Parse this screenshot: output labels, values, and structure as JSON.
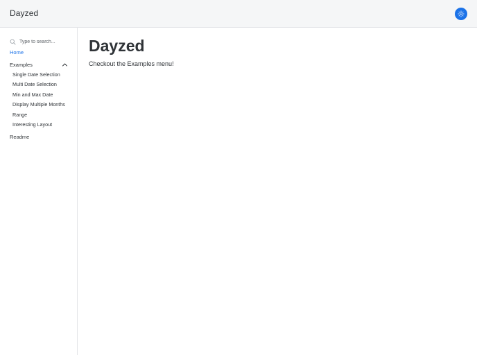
{
  "header": {
    "title": "Dayzed",
    "theme_toggle_icon": "sun-icon",
    "accent_color": "#1b72e8"
  },
  "sidebar": {
    "search": {
      "placeholder": "Type to search...",
      "value": "",
      "icon": "search-icon"
    },
    "home_label": "Home",
    "examples": {
      "label": "Examples",
      "expanded": true,
      "icon": "chevron-up-icon",
      "items": [
        {
          "label": "Single Date Selection"
        },
        {
          "label": "Multi Date Selection"
        },
        {
          "label": "Min and Max Date"
        },
        {
          "label": "Display Multiple Months"
        },
        {
          "label": "Range"
        },
        {
          "label": "Interesting Layout"
        }
      ]
    },
    "readme_label": "Readme"
  },
  "main": {
    "title": "Dayzed",
    "text": "Checkout the Examples menu!"
  }
}
